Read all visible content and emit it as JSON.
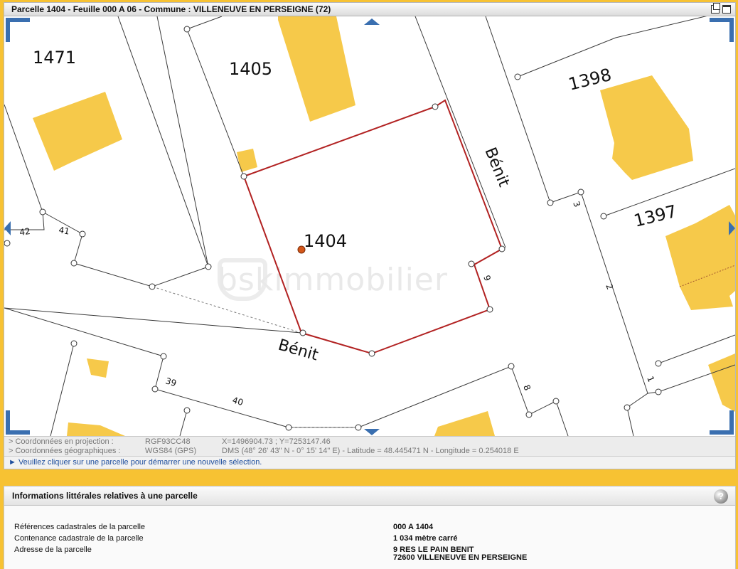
{
  "map": {
    "title": "Parcelle 1404 - Feuille 000 A 06 - Commune : VILLENEUVE EN PERSEIGNE (72)",
    "parcel_labels": [
      "1471",
      "1405",
      "1398",
      "1397",
      "1404"
    ],
    "street_labels": [
      "Bénit",
      "Bénit"
    ],
    "house_numbers": [
      "42",
      "41",
      "39",
      "40",
      "3",
      "9",
      "8",
      "2",
      "1"
    ],
    "watermark": "bskimmobilier",
    "colors": {
      "building": "#f6c94a",
      "selected_parcel": "#b22222",
      "accent": "#3a6fb0",
      "background": "#f7c233"
    }
  },
  "coordinates": {
    "projection": {
      "label": "> Coordonnées en projection :",
      "system": "RGF93CC48",
      "value": "X=1496904.73 ; Y=7253147.46"
    },
    "geographic": {
      "label": "> Coordonnées géographiques :",
      "system": "WGS84 (GPS)",
      "value": "DMS (48° 26' 43\" N - 0° 15' 14\" E) - Latitude = 48.445471 N - Longitude = 0.254018 E"
    }
  },
  "instruction": "► Veuillez cliquer sur une parcelle pour démarrer une nouvelle sélection.",
  "info": {
    "title": "Informations littérales relatives à une parcelle",
    "help": "?",
    "rows": [
      {
        "label": "Références cadastrales de la parcelle",
        "value": "000 A 1404"
      },
      {
        "label": "Contenance cadastrale de la parcelle",
        "value": "1 034 mètre carré"
      },
      {
        "label": "Adresse de la parcelle",
        "value": "9 RES LE PAIN BENIT",
        "value2": "72600 VILLENEUVE EN PERSEIGNE"
      }
    ]
  }
}
